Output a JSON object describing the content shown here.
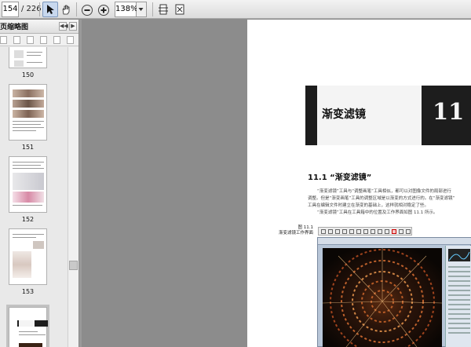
{
  "toolbar": {
    "current_page": "154",
    "total_pages": "/ 226",
    "zoom": "138%"
  },
  "sidebar": {
    "title": "页缩略图",
    "thumbnails": [
      {
        "label": "150"
      },
      {
        "label": "151"
      },
      {
        "label": "152"
      },
      {
        "label": "153"
      },
      {
        "label": ""
      }
    ]
  },
  "page": {
    "chapter_title": "渐变滤镜",
    "chapter_number": "11",
    "section_heading": "11.1 “渐变滤镜”",
    "body_lines": [
      "“渐变滤镜”工具与“调整画笔”工具相似，都可以对图像文件的局部进行",
      "调整。但是“渐变画笔”工具的调整区域是以渐变的方式进行的。在“渐变滤镜”",
      "工具在编辑文件时建立在渐变的基础上，这样就相对稳定了些。",
      "“渐变滤镜”工具在工具箱中的位置及工作界面如图 11.1 所示。"
    ],
    "figure_label_1": "图 11.1",
    "figure_label_2": "渐变滤镜工作界面"
  },
  "colors": {
    "banner_dark": "#1d1d1d",
    "toolbar_selected": "#c8d8ee",
    "canvas_accent": "#c8642a"
  }
}
